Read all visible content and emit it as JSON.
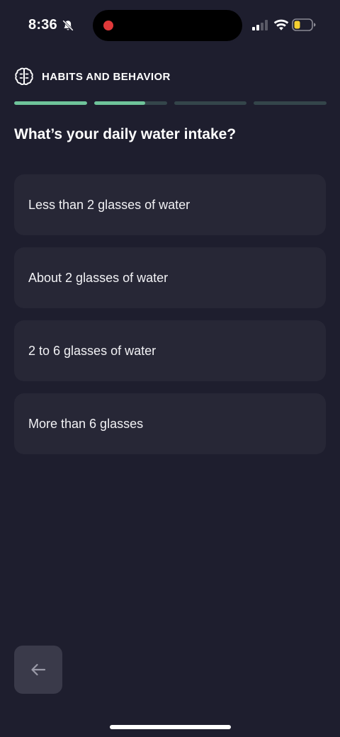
{
  "status_bar": {
    "time": "8:36",
    "icons": [
      "bell-slash-icon",
      "recording-dot-icon",
      "signal-icon",
      "wifi-icon",
      "battery-low-icon"
    ]
  },
  "header": {
    "icon": "brain-icon",
    "title": "HABITS AND BEHAVIOR"
  },
  "progress": {
    "segments": [
      1,
      0.7,
      0,
      0
    ]
  },
  "question": "What’s your daily water intake?",
  "options": [
    {
      "label": "Less than 2 glasses of water"
    },
    {
      "label": "About 2 glasses of water"
    },
    {
      "label": "2 to 6 glasses of water"
    },
    {
      "label": "More than 6 glasses"
    }
  ],
  "back_button": {
    "icon": "arrow-left-icon"
  },
  "colors": {
    "background": "#1e1e2e",
    "card": "#272736",
    "progress_fill": "#6fc49a",
    "progress_track": "#34454a",
    "back_button": "#3a3a4a",
    "recording": "#e0393a",
    "battery": "#f5d02f"
  }
}
